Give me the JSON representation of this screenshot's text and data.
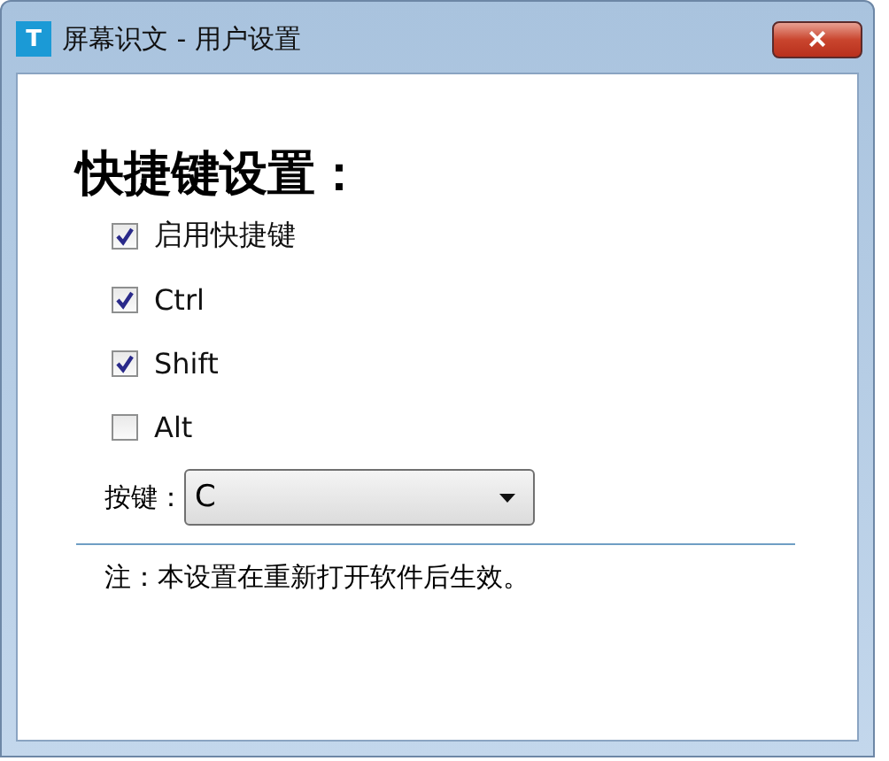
{
  "window": {
    "icon": "T",
    "title": "屏幕识文 - 用户设置",
    "close": "×"
  },
  "heading": "快捷键设置：",
  "options": [
    {
      "label": "启用快捷键",
      "checked": true
    },
    {
      "label": "Ctrl",
      "checked": true
    },
    {
      "label": "Shift",
      "checked": true
    },
    {
      "label": "Alt",
      "checked": false
    }
  ],
  "key": {
    "label": "按键：",
    "value": "C"
  },
  "note": "注：本设置在重新打开软件后生效。"
}
